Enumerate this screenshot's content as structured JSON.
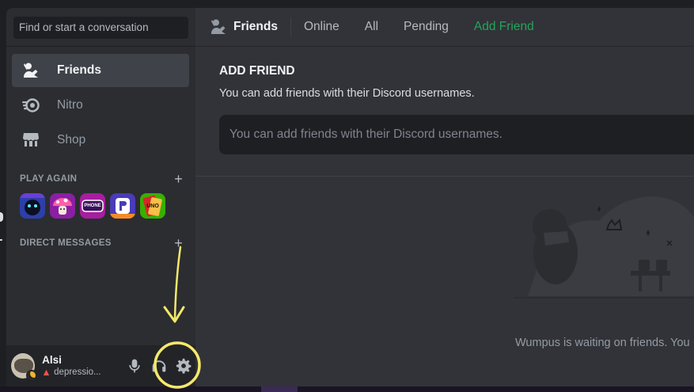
{
  "search": {
    "placeholder": "Find or start a conversation"
  },
  "nav": [
    {
      "label": "Friends",
      "icon": "friends-icon",
      "active": true
    },
    {
      "label": "Nitro",
      "icon": "nitro-icon",
      "active": false
    },
    {
      "label": "Shop",
      "icon": "shop-icon",
      "active": false
    }
  ],
  "play_again": {
    "header": "PLAY AGAIN",
    "games": [
      {
        "icon": "game-shadow-icon",
        "color": "#3b5bdb"
      },
      {
        "icon": "game-mushroom-icon",
        "color": "#d6336c"
      },
      {
        "icon": "game-gartic-phone-icon",
        "color": "#9c36b5",
        "text": "PHONE"
      },
      {
        "icon": "game-putt-party-icon",
        "color": "#5c4ee5"
      },
      {
        "icon": "game-uno-icon",
        "color": "#2f9e44",
        "text": "UNO"
      }
    ]
  },
  "direct_messages": {
    "header": "DIRECT MESSAGES"
  },
  "user": {
    "name": "Alsi",
    "status": "depressio...",
    "status_color": "#f0b232"
  },
  "header": {
    "title": "Friends",
    "tabs": [
      "Online",
      "All",
      "Pending"
    ],
    "add_friend_tab": "Add Friend",
    "add_friend_color": "#23a55a"
  },
  "add_friend": {
    "title": "ADD FRIEND",
    "subtitle": "You can add friends with their Discord usernames.",
    "input_placeholder": "You can add friends with their Discord usernames."
  },
  "empty_state": {
    "text": "Wumpus is waiting on friends. You"
  },
  "colors": {
    "annotation": "#f5e96b",
    "accent_green": "#23a55a"
  }
}
